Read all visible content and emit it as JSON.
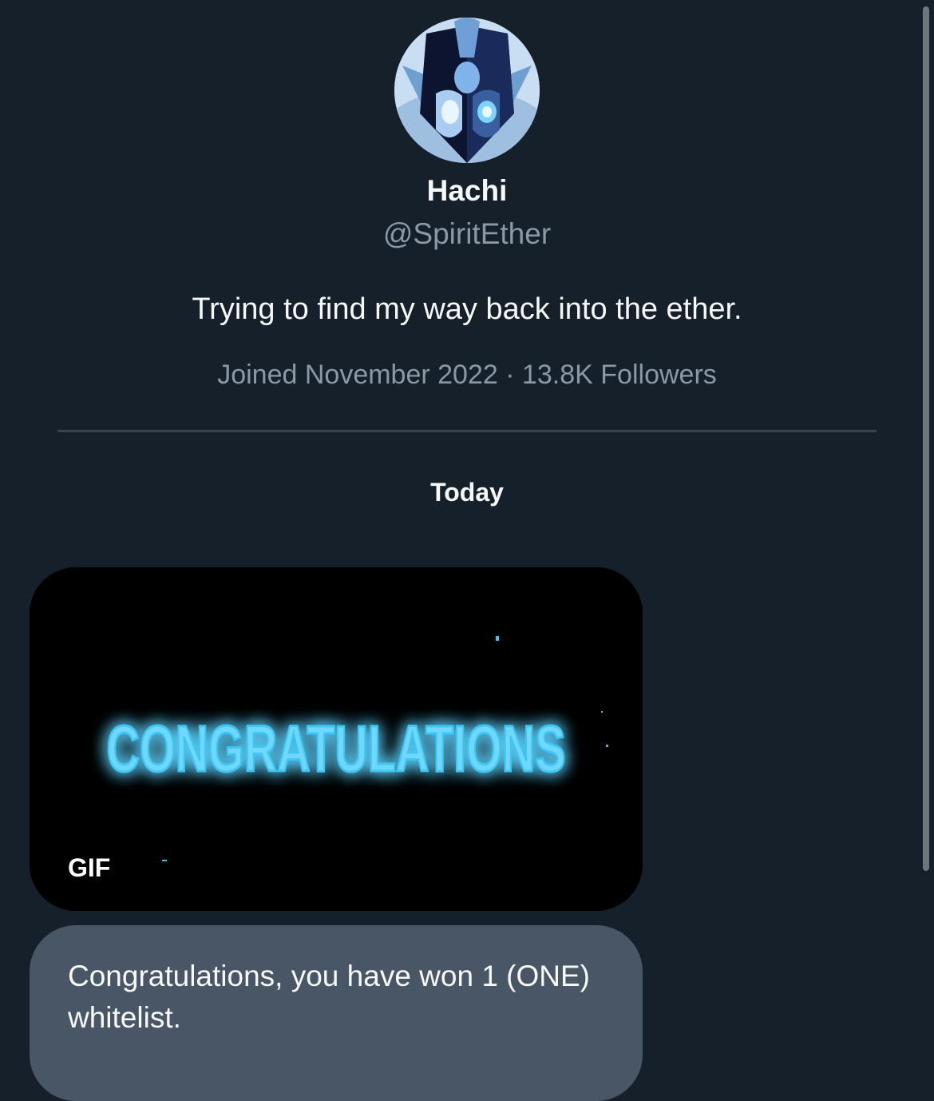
{
  "profile": {
    "display_name": "Hachi",
    "handle": "@SpiritEther",
    "bio": "Trying to find my way back into the ether.",
    "meta": "Joined November 2022 · 13.8K Followers",
    "avatar_icon": "spirit-avatar"
  },
  "conversation": {
    "date_label": "Today",
    "gif": {
      "text": "CONGRATULATIONS",
      "badge": "GIF",
      "glow_color": "#3ec6f5"
    },
    "message": {
      "text": "Congratulations, you have won 1 (ONE) whitelist."
    }
  },
  "colors": {
    "background": "#15202b",
    "bubble": "#485665",
    "secondary_text": "#8b98a5"
  }
}
